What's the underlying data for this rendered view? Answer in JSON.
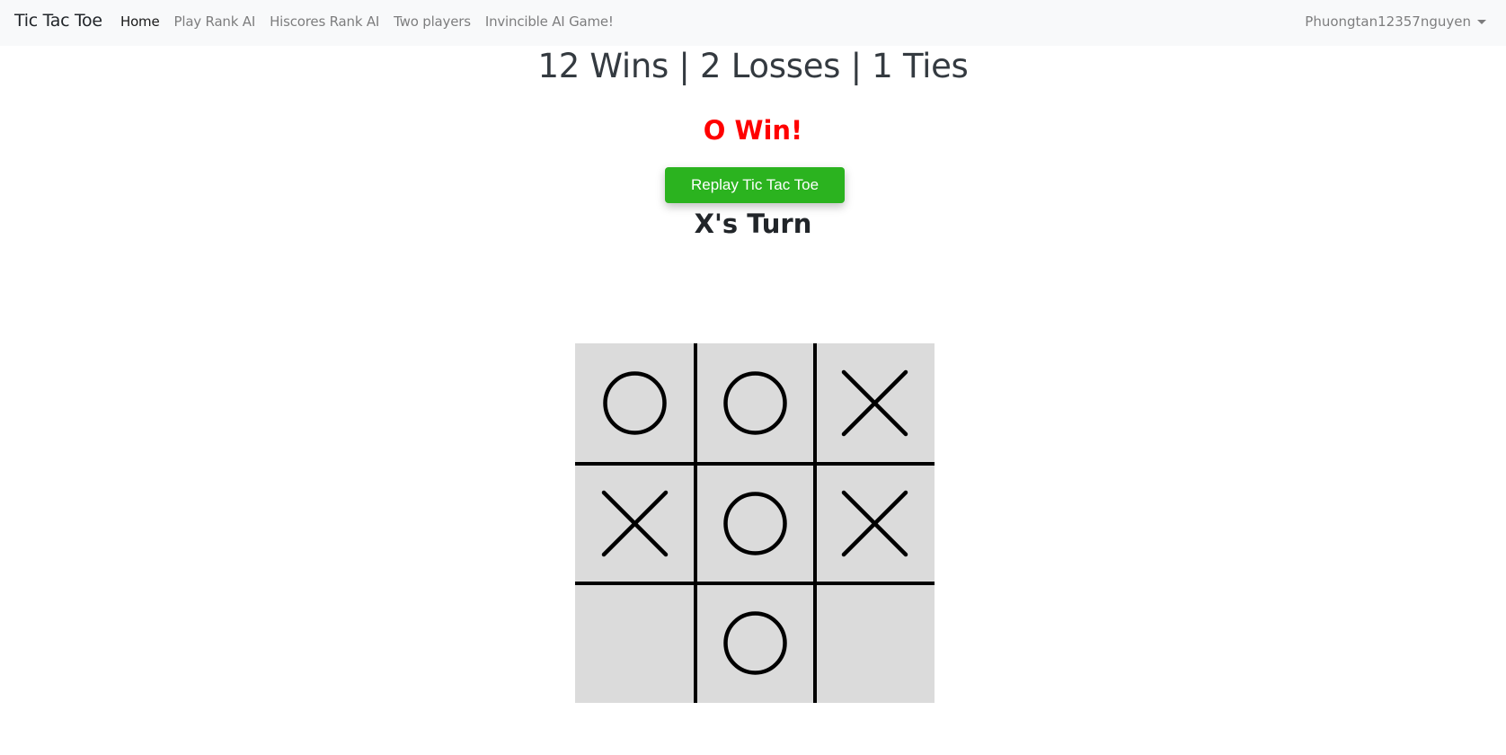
{
  "navbar": {
    "brand": "Tic Tac Toe",
    "links": [
      {
        "label": "Home",
        "active": true
      },
      {
        "label": "Play Rank AI",
        "active": false
      },
      {
        "label": "Hiscores Rank AI",
        "active": false
      },
      {
        "label": "Two players",
        "active": false
      },
      {
        "label": "Invincible AI Game!",
        "active": false
      }
    ],
    "user": "Phuongtan12357nguyen"
  },
  "stats": {
    "wins": 12,
    "losses": 2,
    "ties": 1,
    "text": "12 Wins | 2 Losses | 1 Ties"
  },
  "result": {
    "text": "O Win!",
    "color": "#ff0000"
  },
  "replay_button": {
    "label": "Replay Tic Tac Toe",
    "color": "#2bb31f"
  },
  "turn": {
    "text": "X's Turn"
  },
  "board": {
    "cells": [
      "O",
      "O",
      "X",
      "X",
      "O",
      "X",
      "",
      "O",
      ""
    ],
    "background": "#dbdbdb"
  }
}
